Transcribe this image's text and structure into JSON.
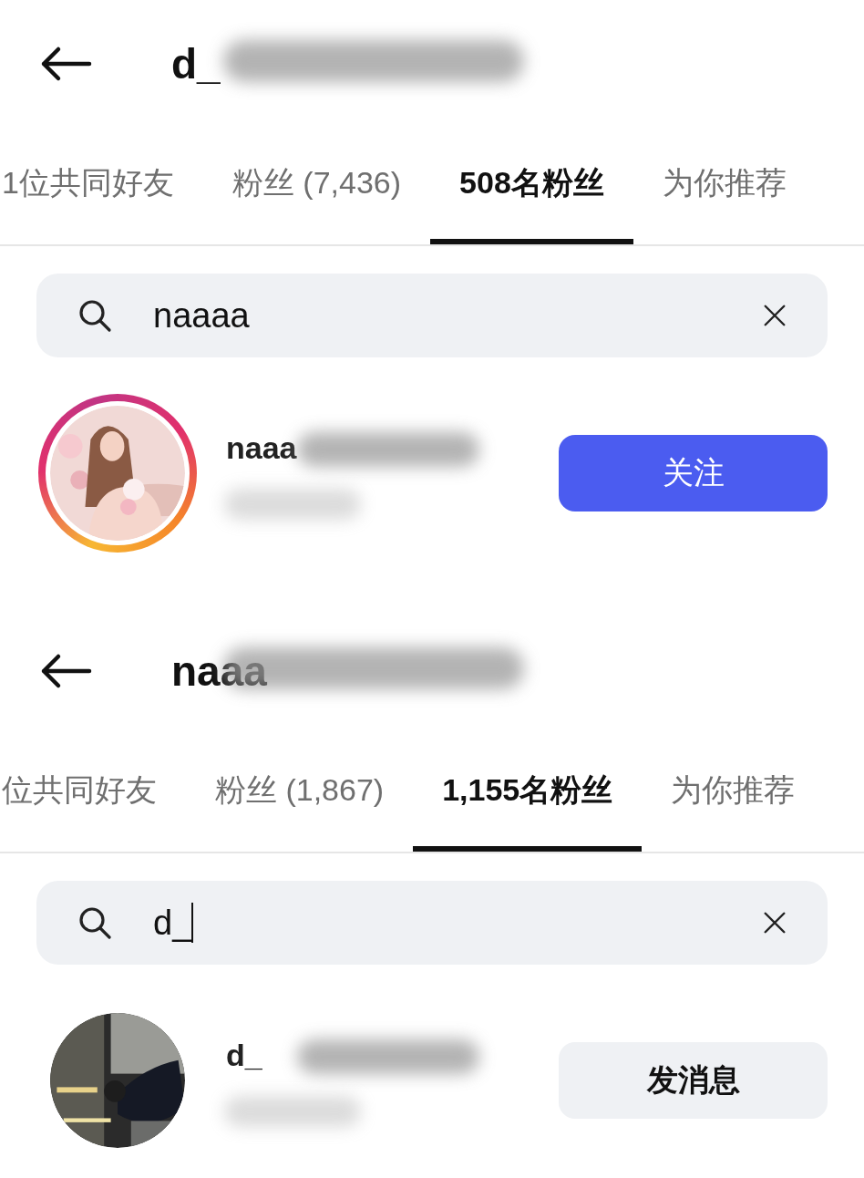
{
  "panels": [
    {
      "header": {
        "title": "d_",
        "title_redacted": true
      },
      "tabs": [
        {
          "label": "1位共同好友",
          "selected": false
        },
        {
          "label": "粉丝 (7,436)",
          "selected": false
        },
        {
          "label": "508名粉丝",
          "selected": true
        },
        {
          "label": "为你推荐",
          "selected": false
        }
      ],
      "search": {
        "value": "naaaa",
        "focused": false
      },
      "result": {
        "username": "naaa",
        "redacted": true,
        "has_story": true,
        "button": {
          "label": "关注",
          "kind": "follow"
        }
      }
    },
    {
      "header": {
        "title": "naaa",
        "title_redacted": true
      },
      "tabs": [
        {
          "label": "位共同好友",
          "selected": false
        },
        {
          "label": "粉丝 (1,867)",
          "selected": false
        },
        {
          "label": "1,155名粉丝",
          "selected": true
        },
        {
          "label": "为你推荐",
          "selected": false
        }
      ],
      "search": {
        "value": "d_",
        "focused": true
      },
      "result": {
        "username": "d_",
        "redacted": true,
        "has_story": false,
        "button": {
          "label": "发消息",
          "kind": "message"
        }
      }
    }
  ]
}
